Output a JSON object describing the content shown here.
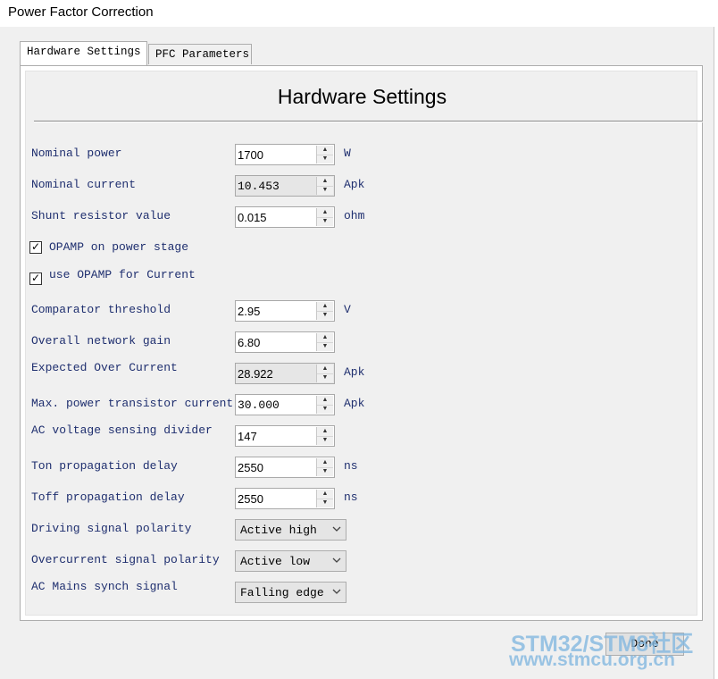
{
  "window": {
    "title": "Power Factor Correction"
  },
  "tabs": [
    {
      "label": "Hardware Settings",
      "active": true
    },
    {
      "label": "PFC Parameters",
      "active": false
    }
  ],
  "heading": "Hardware Settings",
  "fields": {
    "nominal_power": {
      "label": "Nominal power",
      "value": "1700",
      "unit": "W"
    },
    "nominal_current": {
      "label": "Nominal current",
      "value": "10.453",
      "unit": "Apk"
    },
    "shunt_resistor": {
      "label": "Shunt resistor value",
      "value": "0.015",
      "unit": "ohm"
    },
    "comparator_threshold": {
      "label": "Comparator threshold",
      "value": "2.95",
      "unit": "V"
    },
    "network_gain": {
      "label": "Overall network gain",
      "value": "6.80"
    },
    "expected_over_current": {
      "label": "Expected Over Current",
      "value": "28.922",
      "unit": "Apk"
    },
    "max_transistor_current": {
      "label": "Max. power transistor current",
      "value": "30.000",
      "unit": "Apk"
    },
    "ac_voltage_divider": {
      "label": "AC voltage sensing divider",
      "value": "147"
    },
    "ton_delay": {
      "label": "Ton propagation delay",
      "value": "2550",
      "unit": "ns"
    },
    "toff_delay": {
      "label": "Toff propagation delay",
      "value": "2550",
      "unit": "ns"
    }
  },
  "checkboxes": {
    "opamp_power_stage": {
      "label": "OPAMP on power stage",
      "checked": true
    },
    "opamp_current": {
      "label": "use OPAMP for Current",
      "checked": true
    }
  },
  "selects": {
    "driving_polarity": {
      "label": "Driving signal polarity",
      "value": "Active high"
    },
    "overcurrent_polarity": {
      "label": "Overcurrent signal polarity",
      "value": "Active low"
    },
    "ac_mains_synch": {
      "label": "AC Mains synch signal",
      "value": "Falling edge"
    }
  },
  "done_label": "Done",
  "watermark": {
    "line1": "STM32/STM8社区",
    "line2": "www.stmcu.org.cn"
  },
  "colors": {
    "label_text": "#1f2f6f",
    "background": "#f0f0f0",
    "readonly_field": "#e6e6e6"
  }
}
